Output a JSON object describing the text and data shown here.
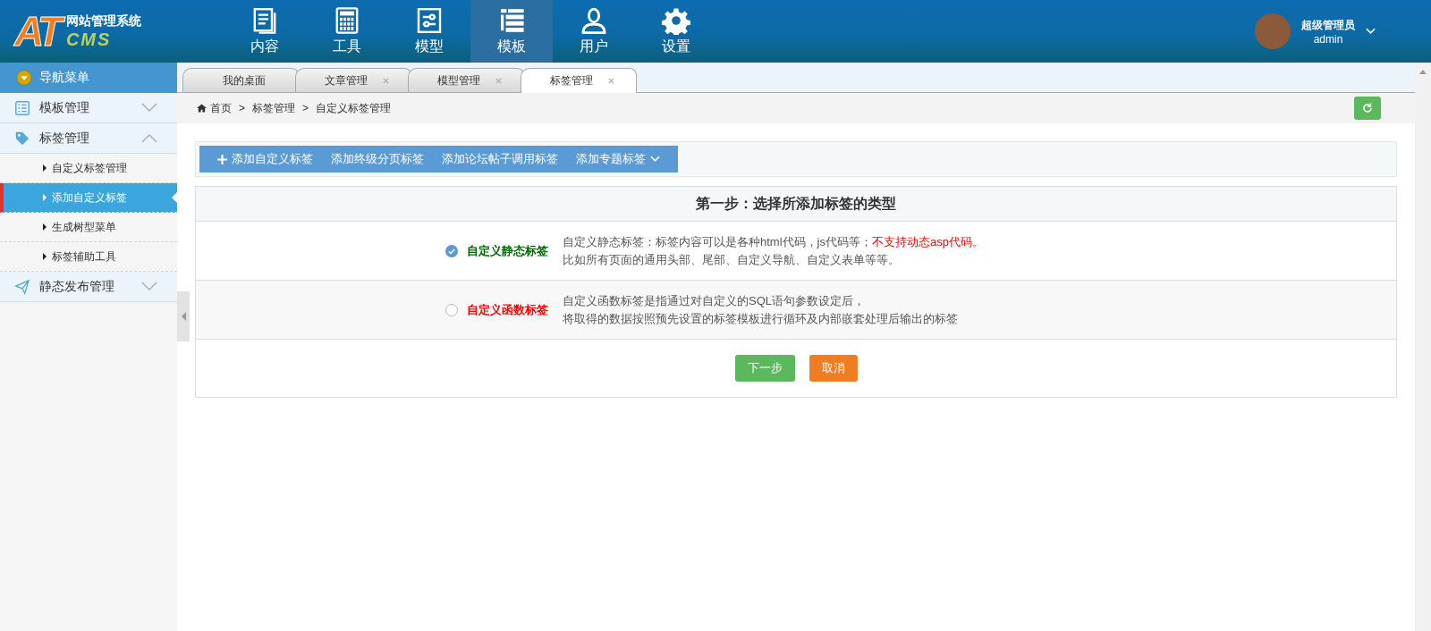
{
  "header": {
    "logo_letters": "AT",
    "logo_title": "网站管理系统",
    "logo_sub": "CMS",
    "nav": [
      {
        "label": "内容",
        "selected": false
      },
      {
        "label": "工具",
        "selected": false
      },
      {
        "label": "模型",
        "selected": false
      },
      {
        "label": "模板",
        "selected": true
      },
      {
        "label": "用户",
        "selected": false
      },
      {
        "label": "设置",
        "selected": false
      }
    ],
    "user": {
      "role": "超级管理员",
      "name": "admin"
    }
  },
  "sidebar": {
    "title": "导航菜单",
    "groups": [
      {
        "label": "模板管理",
        "expanded": false
      },
      {
        "label": "标签管理",
        "expanded": true,
        "children": [
          {
            "label": "自定义标签管理",
            "selected": false
          },
          {
            "label": "添加自定义标签",
            "selected": true
          },
          {
            "label": "生成树型菜单",
            "selected": false
          },
          {
            "label": "标签辅助工具",
            "selected": false
          }
        ]
      },
      {
        "label": "静态发布管理",
        "expanded": false
      }
    ]
  },
  "tabs": [
    {
      "label": "我的桌面",
      "closable": false,
      "selected": false
    },
    {
      "label": "文章管理",
      "closable": true,
      "selected": false
    },
    {
      "label": "模型管理",
      "closable": true,
      "selected": false
    },
    {
      "label": "标签管理",
      "closable": true,
      "selected": true
    }
  ],
  "breadcrumb": {
    "items": [
      "首页",
      "标签管理",
      "自定义标签管理"
    ],
    "separators": [
      ">",
      ">"
    ]
  },
  "toolbar": [
    {
      "label": "添加自定义标签",
      "kind": "add"
    },
    {
      "label": "添加终级分页标签",
      "kind": "plain"
    },
    {
      "label": "添加论坛帖子调用标签",
      "kind": "plain"
    },
    {
      "label": "添加专题标签",
      "kind": "dropdown"
    }
  ],
  "panel": {
    "title": "第一步：选择所添加标签的类型",
    "options": [
      {
        "label": "自定义静态标签",
        "color": "#006600",
        "selected": true,
        "lines": [
          "自定义静态标签：标签内容可以是各种html代码，js代码等；",
          "比如所有页面的通用头部、尾部、自定义导航、自定义表单等等。"
        ],
        "warning": "不支持动态asp代码。"
      },
      {
        "label": "自定义函数标签",
        "color": "#ff0000",
        "selected": false,
        "lines": [
          "自定义函数标签是指通过对自定义的SQL语句参数设定后，",
          "将取得的数据按照预先设置的标签模板进行循环及内部嵌套处理后输出的标签"
        ]
      }
    ],
    "buttons": [
      {
        "label": "下一步",
        "kind": "primary"
      },
      {
        "label": "取消",
        "kind": "cancel"
      }
    ]
  }
}
